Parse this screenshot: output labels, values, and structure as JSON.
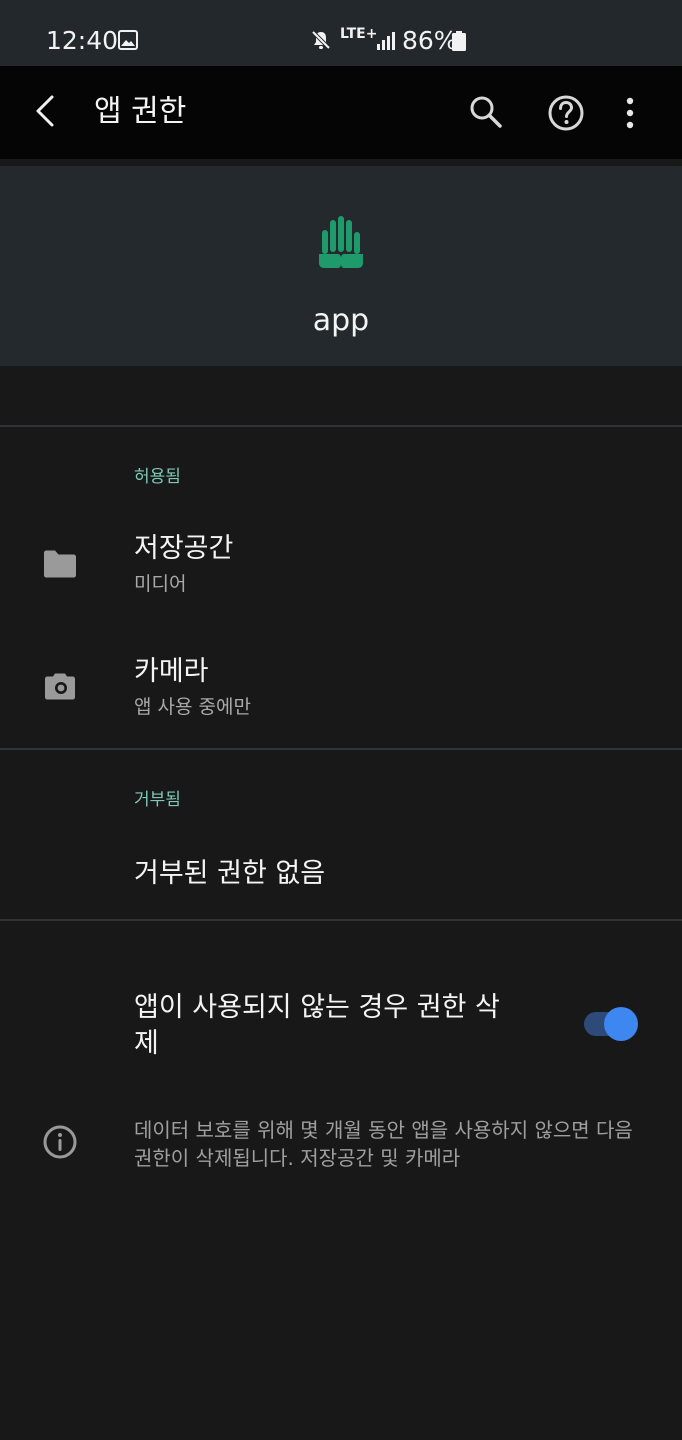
{
  "status_bar": {
    "time": "12:40",
    "network": "LTE+",
    "battery": "86%"
  },
  "app_bar": {
    "title": "앱 권한"
  },
  "app": {
    "name": "app",
    "icon_color": "#1f9a6b"
  },
  "allowed": {
    "header": "허용됨",
    "items": [
      {
        "title": "저장공간",
        "subtitle": "미디어",
        "icon": "folder-icon"
      },
      {
        "title": "카메라",
        "subtitle": "앱 사용 중에만",
        "icon": "camera-icon"
      }
    ]
  },
  "denied": {
    "header": "거부됨",
    "empty_text": "거부된 권한 없음"
  },
  "auto_remove": {
    "label": "앱이 사용되지 않는 경우 권한 삭제",
    "enabled": true,
    "accent_color": "#3e86f0"
  },
  "info": {
    "text": "데이터 보호를 위해 몇 개월 동안 앱을 사용하지 않으면 다음 권한이 삭제됩니다. 저장공간 및 카메라"
  }
}
